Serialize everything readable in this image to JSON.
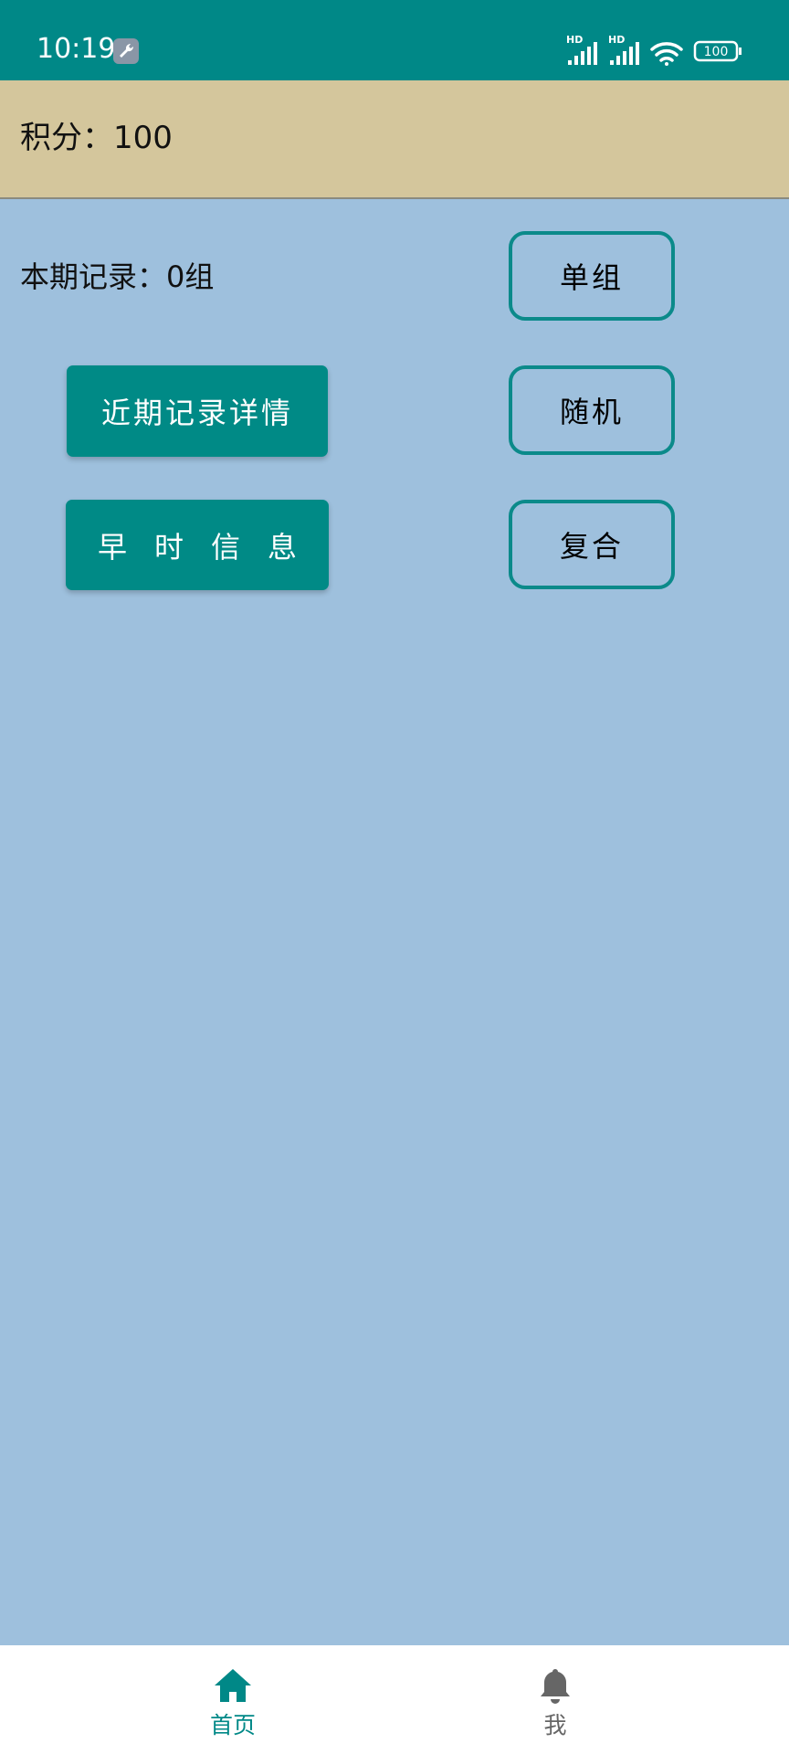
{
  "status_bar": {
    "time": "10:19",
    "icons": [
      "wrench-icon",
      "signal-hd-icon",
      "signal-hd-icon",
      "wifi-icon",
      "battery-icon"
    ],
    "battery": "100",
    "background": "#008887"
  },
  "score": {
    "text": "积分：100",
    "background": "#d4c69c"
  },
  "record": {
    "text": "本期记录：0组"
  },
  "buttons": {
    "detail": "近期记录详情",
    "info": "早时信息",
    "single": "单组",
    "random": "随机",
    "composite": "复合"
  },
  "nav": {
    "home": "首页",
    "me": "我",
    "active": "首页"
  },
  "colors": {
    "primary": "#008887",
    "page_background": "#9ec0dd",
    "outline": "#0b8a8a"
  }
}
